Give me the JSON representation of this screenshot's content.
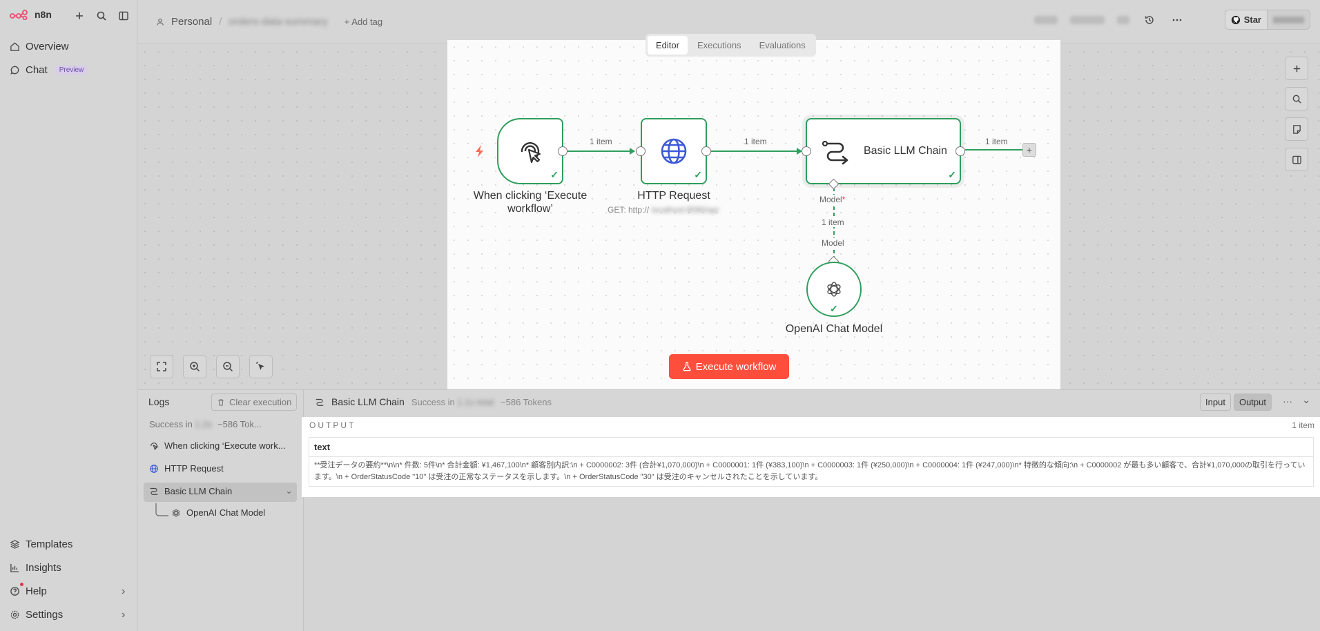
{
  "sidebar": {
    "logo_text": "n8n",
    "items_top": [
      {
        "label": "Overview"
      },
      {
        "label": "Chat",
        "badge": "Preview"
      }
    ],
    "items_bottom": [
      {
        "label": "Templates"
      },
      {
        "label": "Insights"
      },
      {
        "label": "Help"
      },
      {
        "label": "Settings"
      }
    ]
  },
  "header": {
    "breadcrumb_owner": "Personal",
    "workflow_name": "orders-data-summary",
    "add_tag": "+ Add tag",
    "github_star": "Star"
  },
  "canvas": {
    "tabs": [
      "Editor",
      "Executions",
      "Evaluations"
    ],
    "active_tab": "Editor",
    "nodes": {
      "trigger": {
        "label": "When clicking ‘Execute workflow’"
      },
      "http": {
        "label": "HTTP Request",
        "subtitle": "GET: http://"
      },
      "chain": {
        "label": "Basic LLM Chain"
      },
      "openai": {
        "label": "OpenAI Chat Model"
      }
    },
    "connections": {
      "c1": "1 item",
      "c2": "1 item",
      "c3": "1 item",
      "model_top": "Model",
      "model_required": "*",
      "model_mid": "1 item",
      "model_bottom": "Model"
    },
    "execute_button": "Execute workflow"
  },
  "logs": {
    "title": "Logs",
    "clear_button": "Clear execution",
    "status_prefix": "Success in",
    "tokens": "~586 Tok...",
    "items": [
      {
        "label": "When clicking ‘Execute work...",
        "icon": "cursor-click-icon"
      },
      {
        "label": "HTTP Request",
        "icon": "globe-icon"
      },
      {
        "label": "Basic LLM Chain",
        "icon": "chain-icon"
      },
      {
        "label": "OpenAI Chat Model",
        "icon": "openai-icon"
      }
    ]
  },
  "output_panel": {
    "node_name": "Basic LLM Chain",
    "status": "Success in",
    "tokens": "~586 Tokens",
    "input_btn": "Input",
    "output_btn": "Output",
    "section_label": "OUTPUT",
    "item_count": "1 item",
    "column": "text",
    "value": "**受注データの要約**\\n\\n* 件数: 5件\\n* 合計金額: ¥1,467,100\\n* 顧客別内訳:\\n + C0000002: 3件 (合計¥1,070,000)\\n + C0000001: 1件 (¥383,100)\\n   + C0000003: 1件 (¥250,000)\\n   + C0000004: 1件 (¥247,000)\\n* 特徴的な傾向:\\n   + C0000002 が最も多い顧客で、合計¥1,070,000の取引を行っています。\\n   + OrderStatusCode \"10\" は受注の正常なステータスを示します。\\n + OrderStatusCode \"30\" は受注のキャンセルされたことを示しています。"
  },
  "colors": {
    "accent_green": "#2e9e5b",
    "execute_red": "#ff4f3c",
    "brand": "#ea4b71"
  }
}
